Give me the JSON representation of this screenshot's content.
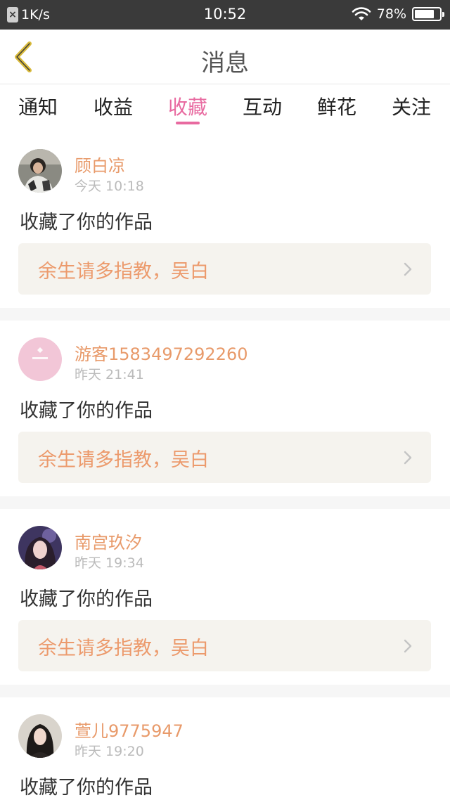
{
  "status_bar": {
    "speed": "1K/s",
    "time": "10:52",
    "battery": "78%",
    "battery_level": 0.78
  },
  "header": {
    "title": "消息",
    "back_icon": "back-chevron-icon"
  },
  "tabs": [
    {
      "label": "通知",
      "active": false
    },
    {
      "label": "收益",
      "active": false
    },
    {
      "label": "收藏",
      "active": true
    },
    {
      "label": "互动",
      "active": false
    },
    {
      "label": "鲜花",
      "active": false
    },
    {
      "label": "关注",
      "active": false
    }
  ],
  "colors": {
    "accent": "#e86aa0",
    "username": "#e89a6a",
    "work_title": "#ec9a6c",
    "work_bg": "#f5f3ee"
  },
  "messages": [
    {
      "user": "顾白凉",
      "time": "今天 10:18",
      "action": "收藏了你的作品",
      "work": "余生请多指教，吴白"
    },
    {
      "user": "游客1583497292260",
      "time": "昨天 21:41",
      "action": "收藏了你的作品",
      "work": "余生请多指教，吴白"
    },
    {
      "user": "南宫玖汐",
      "time": "昨天 19:34",
      "action": "收藏了你的作品",
      "work": "余生请多指教，吴白"
    },
    {
      "user": "萱儿9775947",
      "time": "昨天 19:20",
      "action": "收藏了你的作品"
    }
  ]
}
